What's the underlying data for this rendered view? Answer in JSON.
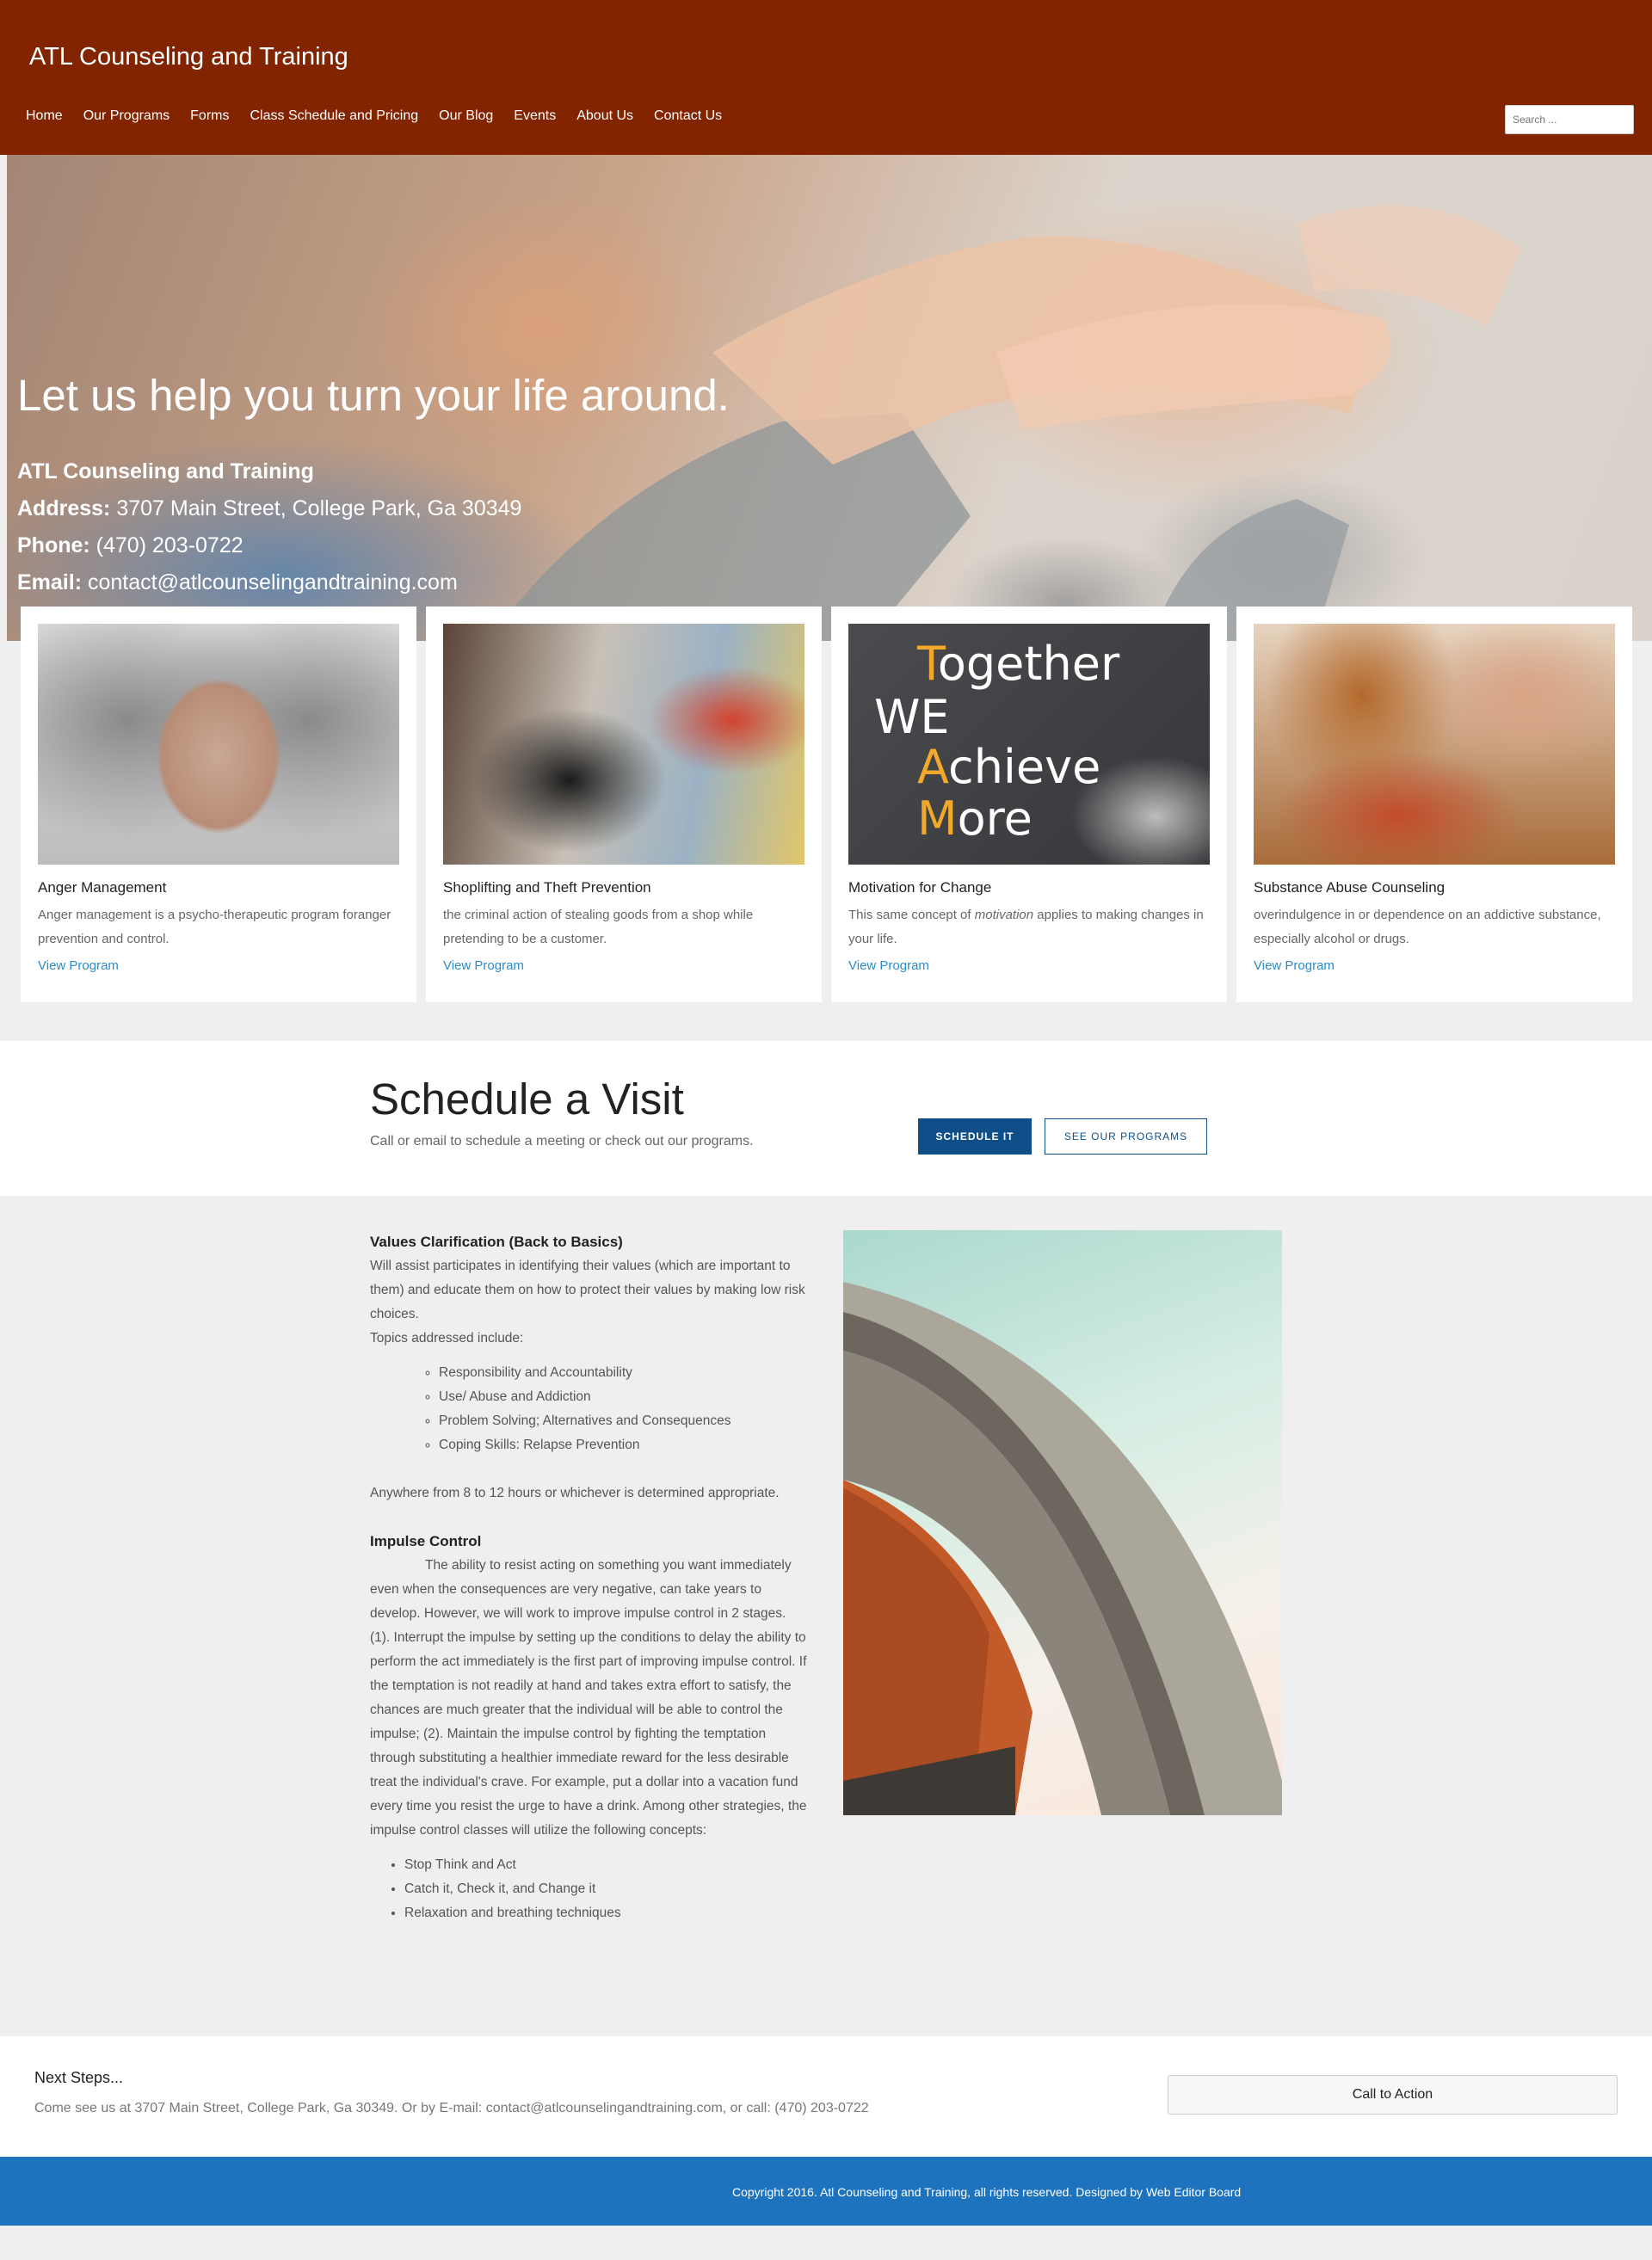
{
  "header": {
    "site_title": "ATL Counseling and Training",
    "nav": [
      "Home",
      "Our Programs",
      "Forms",
      "Class Schedule and Pricing",
      "Our Blog",
      "Events",
      "About Us",
      "Contact Us"
    ],
    "search_placeholder": "Search ..."
  },
  "hero": {
    "headline": "Let us help you turn your life around.",
    "business_name": "ATL Counseling and Training",
    "address_label": "Address:",
    "address": "3707 Main Street, College Park, Ga 30349",
    "phone_label": "Phone:",
    "phone": "(470) 203-0722",
    "email_label": "Email:",
    "email": "contact@atlcounselingandtraining.com"
  },
  "programs": [
    {
      "title": "Anger Management",
      "text": "Anger management is a psycho-therapeutic program foranger prevention and control.",
      "link": "View Program"
    },
    {
      "title": "Shoplifting and Theft Prevention",
      "text": "the criminal action of stealing goods from a shop while pretending to be a customer.",
      "link": "View Program"
    },
    {
      "title": "Motivation for Change",
      "text_pre": "This same concept of ",
      "text_em": "motivation",
      "text_post": " applies to making changes in your life.",
      "link": "View Program",
      "chalk": [
        "T",
        "ogether",
        "WE",
        "A",
        "chieve",
        "M",
        "ore"
      ]
    },
    {
      "title": "Substance Abuse Counseling",
      "text": "overindulgence in or dependence on an addictive substance, especially alcohol or drugs.",
      "link": "View Program"
    }
  ],
  "schedule": {
    "title": "Schedule a Visit",
    "subtitle": "Call or email to schedule a meeting or check out our programs.",
    "primary_button": "SCHEDULE IT",
    "secondary_button": "SEE OUR PROGRAMS"
  },
  "content": {
    "values_title": "Values Clarification (Back to Basics)",
    "values_text": "Will assist participates in identifying their values (which are important to them) and educate them on how to protect their values by making low risk choices.",
    "topics_label": "Topics addressed include:",
    "topics": [
      "Responsibility and Accountability",
      "Use/ Abuse and Addiction",
      "Problem Solving; Alternatives and Consequences",
      "Coping Skills: Relapse Prevention"
    ],
    "hours_text": "Anywhere from 8 to 12 hours or whichever is determined appropriate.",
    "impulse_title": "Impulse Control",
    "impulse_text": "The ability to resist acting on something you want immediately even when the consequences are very negative, can take years to develop. However, we will work to improve impulse control in 2 stages. (1). Interrupt the impulse by setting up the conditions to delay the ability to perform the act immediately is the first part of improving impulse control. If the temptation is not readily at hand and takes extra effort to satisfy, the chances are much greater that the individual will be able to control the impulse; (2). Maintain the impulse control by fighting the temptation through substituting a healthier immediate reward for the less desirable treat the individual's crave. For example, put a dollar into a vacation fund every time you resist the urge to have a drink. Among other strategies, the impulse control classes will utilize the following concepts:",
    "concepts": [
      "Stop Think and Act",
      "Catch it, Check it, and Change it",
      "Relaxation and breathing techniques"
    ]
  },
  "next_steps": {
    "title": "Next Steps...",
    "text": "Come see us at 3707 Main Street, College Park, Ga 30349. Or by E-mail: contact@atlcounselingandtraining.com, or call: (470) 203-0722",
    "button": "Call to Action"
  },
  "footer": {
    "copyright": "Copyright 2016. Atl Counseling and Training, all rights reserved. Designed by ",
    "designer": "Web Editor Board"
  }
}
